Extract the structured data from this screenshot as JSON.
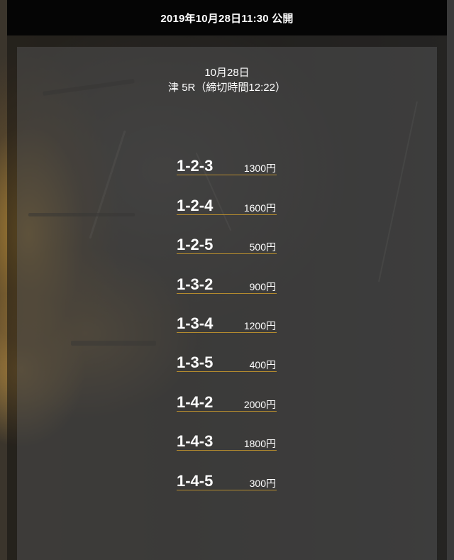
{
  "header": {
    "publish_label": "2019年10月28日11:30 公開"
  },
  "race": {
    "date": "10月28日",
    "detail": "津 5R（締切時間12:22）"
  },
  "bets": [
    {
      "combo": "1-2-3",
      "amount": "1300円"
    },
    {
      "combo": "1-2-4",
      "amount": "1600円"
    },
    {
      "combo": "1-2-5",
      "amount": "500円"
    },
    {
      "combo": "1-3-2",
      "amount": "900円"
    },
    {
      "combo": "1-3-4",
      "amount": "1200円"
    },
    {
      "combo": "1-3-5",
      "amount": "400円"
    },
    {
      "combo": "1-4-2",
      "amount": "2000円"
    },
    {
      "combo": "1-4-3",
      "amount": "1800円"
    },
    {
      "combo": "1-4-5",
      "amount": "300円"
    }
  ],
  "colors": {
    "underline": "#b38a2e",
    "header_bg": "#050505",
    "panel_bg": "#3e3e3e"
  }
}
